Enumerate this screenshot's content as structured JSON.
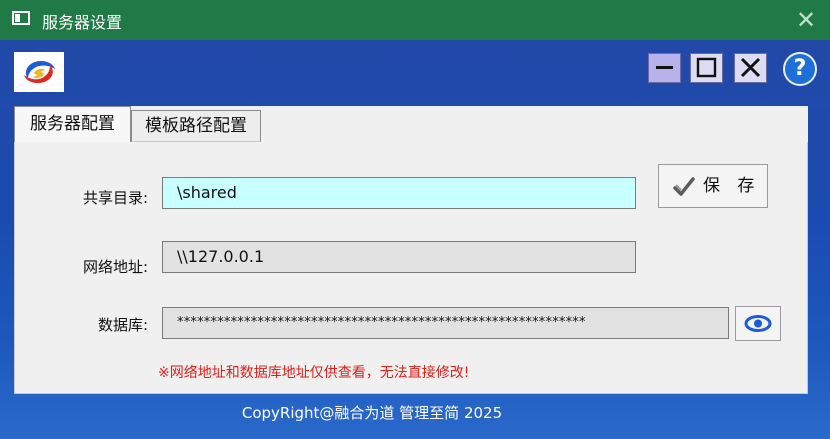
{
  "window": {
    "title": "服务器设置",
    "close_glyph": "✕"
  },
  "toolbar": {
    "help_label": "?"
  },
  "tabs": [
    {
      "label": "服务器配置"
    },
    {
      "label": "模板路径配置"
    }
  ],
  "form": {
    "share": {
      "label": "共享目录:",
      "value": "\\shared"
    },
    "net": {
      "label": "网络地址:",
      "value": "\\\\127.0.0.1"
    },
    "db": {
      "label": "数据库:",
      "value": "*************************************************************"
    }
  },
  "buttons": {
    "save_label": "保 存"
  },
  "note": "※网络地址和数据库地址仅供查看，无法直接修改!",
  "footer": "CopyRight@融合为道 管理至简 2025",
  "colors": {
    "titlebar": "#1f7a45",
    "window_bg": "#1c4aa0",
    "share_field": "#c8ffff",
    "note_red": "#e0201a"
  }
}
